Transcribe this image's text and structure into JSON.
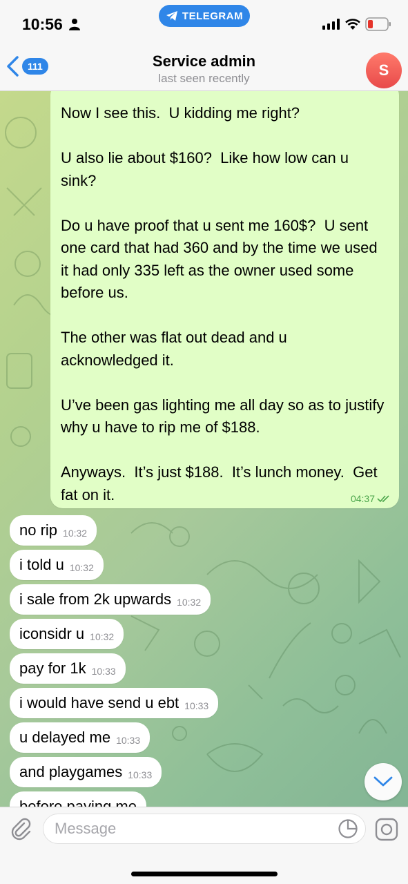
{
  "status_bar": {
    "time": "10:56",
    "app_pill_label": "TELEGRAM"
  },
  "header": {
    "unread_count": "111",
    "title": "Service admin",
    "subtitle": "last seen recently",
    "avatar_letter": "S"
  },
  "messages": {
    "outgoing": {
      "text": "Now I see this.  U kidding me right?\n\nU also lie about $160?  Like how low can u sink?\n\nDo u have proof that u sent me 160$?  U sent one card that had 360 and by the time we used it had only 335 left as the owner used some before us.\n\nThe other was flat out dead and u acknowledged it.\n\nU’ve been gas lighting me all day so as to justify why u have to rip me of $188.\n\nAnyways.  It’s just $188.  It’s lunch money.  Get fat on it.",
      "time": "04:37"
    },
    "incoming": [
      {
        "text": "no rip",
        "time": "10:32"
      },
      {
        "text": "i told u",
        "time": "10:32"
      },
      {
        "text": "i sale from 2k upwards",
        "time": "10:32"
      },
      {
        "text": "iconsidr u",
        "time": "10:32"
      },
      {
        "text": "pay for 1k",
        "time": "10:33"
      },
      {
        "text": "i would have send u ebt",
        "time": "10:33"
      },
      {
        "text": "u delayed me",
        "time": "10:33"
      },
      {
        "text": "and playgames",
        "time": "10:33"
      },
      {
        "text": "before paying me",
        "time": ""
      }
    ]
  },
  "input": {
    "placeholder": "Message"
  },
  "colors": {
    "accent": "#2f86e8",
    "outgoing_bubble": "#e1fec6",
    "read_check": "#4aa54a"
  }
}
